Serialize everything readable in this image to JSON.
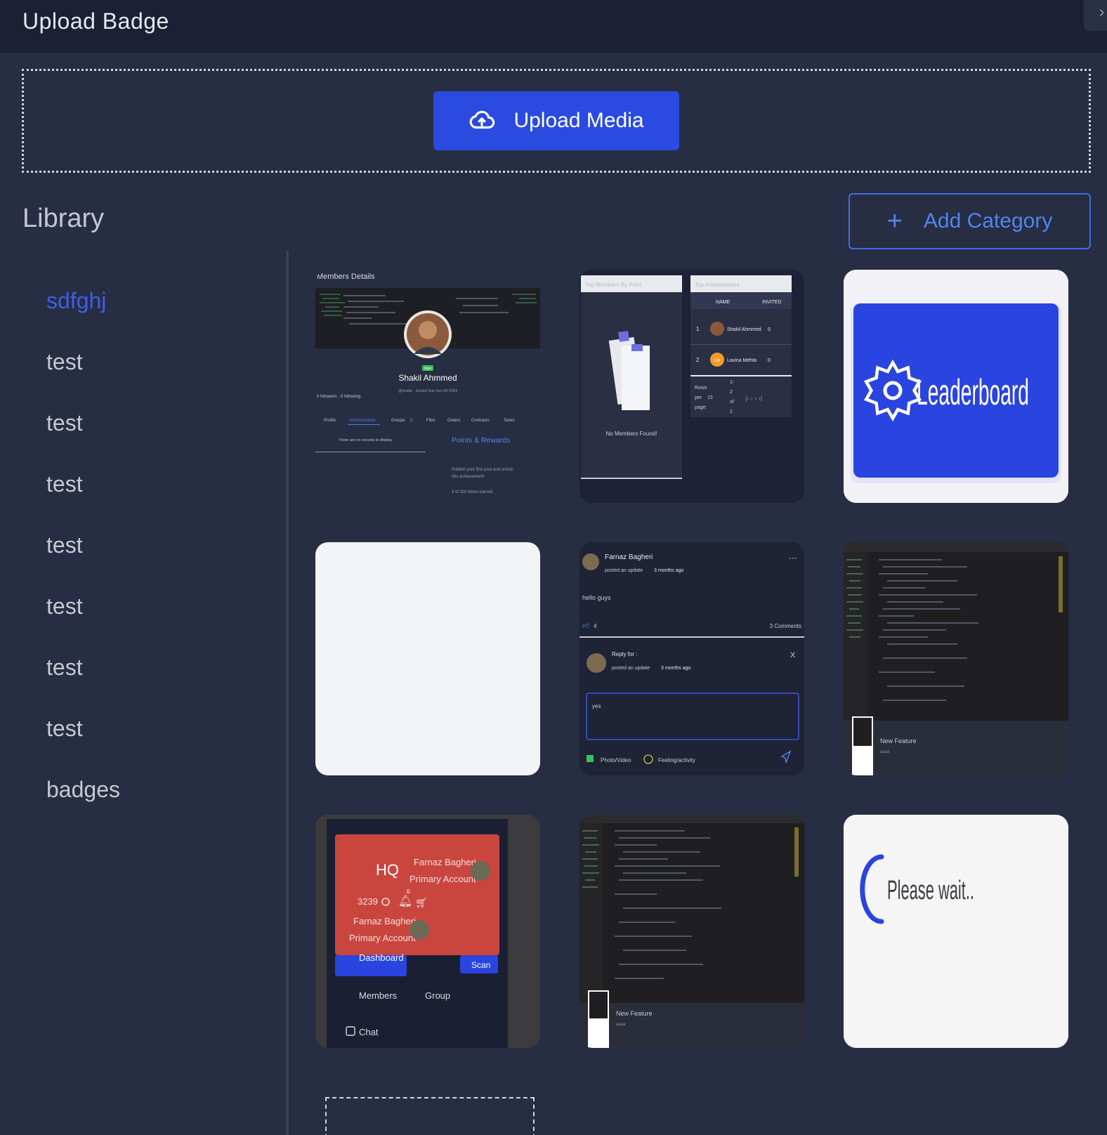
{
  "header": {
    "title": "Upload Badge",
    "close_icon": "chevron-right-icon"
  },
  "upload": {
    "button_label": "Upload Media",
    "icon": "cloud-upload-icon"
  },
  "library": {
    "title": "Library",
    "add_category_label": "Add Category",
    "categories": [
      {
        "label": "sdfghj",
        "active": true
      },
      {
        "label": "test"
      },
      {
        "label": "test"
      },
      {
        "label": "test"
      },
      {
        "label": "test"
      },
      {
        "label": "test"
      },
      {
        "label": "test"
      },
      {
        "label": "test"
      },
      {
        "label": "badges"
      }
    ]
  },
  "media": {
    "t1": {
      "heading": "Members Details",
      "role": "User",
      "name": "Shakil Ahmmed",
      "meta": "@shakil · Joined Sun Jun 09 2024",
      "follow": "0 followers · 0 following",
      "tabs": [
        "Profile",
        "Achievements",
        "Groups",
        "Files",
        "Orders",
        "Contracts",
        "Tasks"
      ],
      "groups_count": "0",
      "empty": "There are no records to display",
      "side_title": "Points & Rewards",
      "side_text_1": "Publish your first post and unlock",
      "side_text_2": "this achievement!",
      "side_count": "3 of 100 times earned"
    },
    "t2": {
      "left_title": "Top Members By Point",
      "right_title": "Top Ambassadors",
      "col_name": "NAME",
      "col_invited": "INVITED",
      "rows": [
        {
          "rank": "1",
          "initials": "",
          "name": "Shakil Ahmmed",
          "invited": "0"
        },
        {
          "rank": "2",
          "initials": "LM",
          "name": "Lavina Mehta",
          "invited": "0"
        }
      ],
      "empty": "No Members Found!",
      "rows_label_1": "Rows",
      "rows_label_2": "per",
      "rows_label_3": "page:",
      "rows_value": "15",
      "range_1": "1-",
      "range_2": "2",
      "range_3": "of",
      "range_4": "2"
    },
    "t3": {
      "label": "Leaderboard"
    },
    "t5": {
      "author": "Farnaz Bagheri",
      "meta_prefix": "posted an update",
      "meta_time": "3 months ago",
      "body": "hello guys",
      "likes": "4",
      "comments": "3 Comments",
      "reply_title": "Reply for :",
      "reply_prefix": "posted an update",
      "reply_time": "3 months ago",
      "reply_text": "yes",
      "photo": "Photo/Video",
      "feeling": "Feeling/activity",
      "close": "X"
    },
    "t6": {
      "caption": "New Feature",
      "sub": "aaaa"
    },
    "t7": {
      "logo": "HQ",
      "name": "Farnaz Bagheri",
      "account": "Primary Account",
      "points": "3239",
      "bell_count": "0",
      "dashboard": "Dashboard",
      "scan": "Scan",
      "members": "Members",
      "group": "Group",
      "chat": "Chat"
    },
    "t8": {
      "caption": "New Feature",
      "sub": "aaaa"
    },
    "t9": {
      "text": "Please wait.."
    }
  },
  "colors": {
    "accent": "#2a4ae0",
    "active_category": "#3f5ee8",
    "add_category": "#4f86f0"
  }
}
